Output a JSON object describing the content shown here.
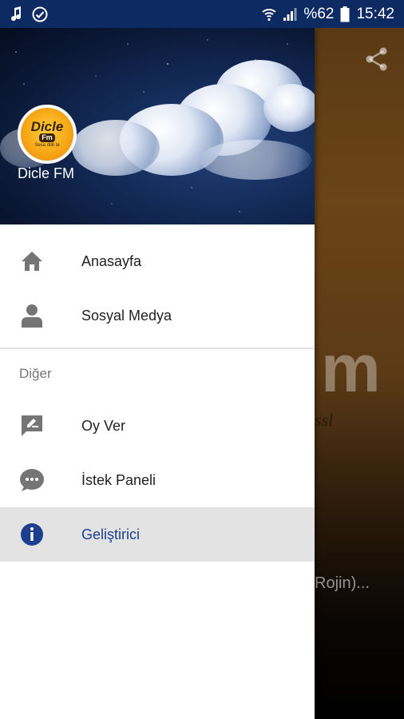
{
  "status_bar": {
    "battery_percent": "%62",
    "time": "15:42",
    "icons": [
      "music-note-icon",
      "check-circle-icon",
      "wifi-icon",
      "signal-icon",
      "battery-icon"
    ]
  },
  "background_app": {
    "logo_text": "m",
    "subtitle": "ssl",
    "track_text": "Rojin)..."
  },
  "drawer": {
    "header": {
      "station_name": "Dicle FM",
      "avatar": {
        "line1": "Dicle",
        "line2": "Fm",
        "line3": "Sesa dilê te"
      }
    },
    "primary_items": [
      {
        "label": "Anasayfa",
        "icon": "home-icon"
      },
      {
        "label": "Sosyal Medya",
        "icon": "person-icon"
      }
    ],
    "section_title": "Diğer",
    "secondary_items": [
      {
        "label": "Oy Ver",
        "icon": "rate-review-icon"
      },
      {
        "label": "İstek Paneli",
        "icon": "chat-bubble-icon"
      },
      {
        "label": "Geliştirici",
        "icon": "info-icon",
        "active": true
      }
    ]
  },
  "colors": {
    "status_bar": "#0d2a63",
    "active_text": "#1d3f8f",
    "active_bg": "#e3e3e3",
    "icon_gray": "#757575"
  }
}
